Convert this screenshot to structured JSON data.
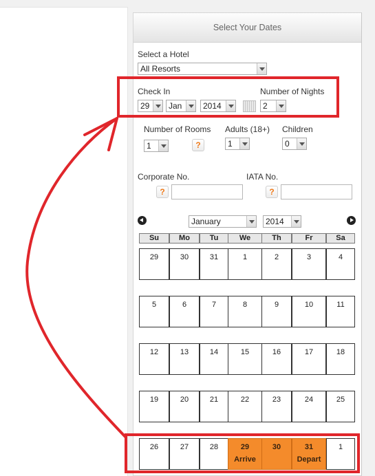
{
  "header": {
    "title": "Select Your Dates"
  },
  "hotel": {
    "label": "Select a Hotel",
    "value": "All Resorts"
  },
  "checkin": {
    "label": "Check In",
    "day": "29",
    "month": "Jan",
    "year": "2014",
    "nights_label": "Number of Nights",
    "nights": "2"
  },
  "occupancy": {
    "rooms_label": "Number of Rooms",
    "rooms": "1",
    "adults_label": "Adults (18+)",
    "adults": "1",
    "children_label": "Children",
    "children": "0",
    "help": "?"
  },
  "codes": {
    "corporate_label": "Corporate No.",
    "iata_label": "IATA No.",
    "corporate_value": "",
    "iata_value": ""
  },
  "calendar": {
    "month": "January",
    "year": "2014",
    "weekdays": [
      "Su",
      "Mo",
      "Tu",
      "We",
      "Th",
      "Fr",
      "Sa"
    ],
    "weeks": [
      [
        "29",
        "30",
        "31",
        "1",
        "2",
        "3",
        "4"
      ],
      [
        "5",
        "6",
        "7",
        "8",
        "9",
        "10",
        "11"
      ],
      [
        "12",
        "13",
        "14",
        "15",
        "16",
        "17",
        "18"
      ],
      [
        "19",
        "20",
        "21",
        "22",
        "23",
        "24",
        "25"
      ],
      [
        "26",
        "27",
        "28",
        "29",
        "30",
        "31",
        "1"
      ]
    ],
    "arrive_label": "Arrive",
    "depart_label": "Depart"
  },
  "colors": {
    "selected_day": "#f48b2b",
    "annotation": "#e0262b",
    "help_icon": "#ef7a1a"
  }
}
